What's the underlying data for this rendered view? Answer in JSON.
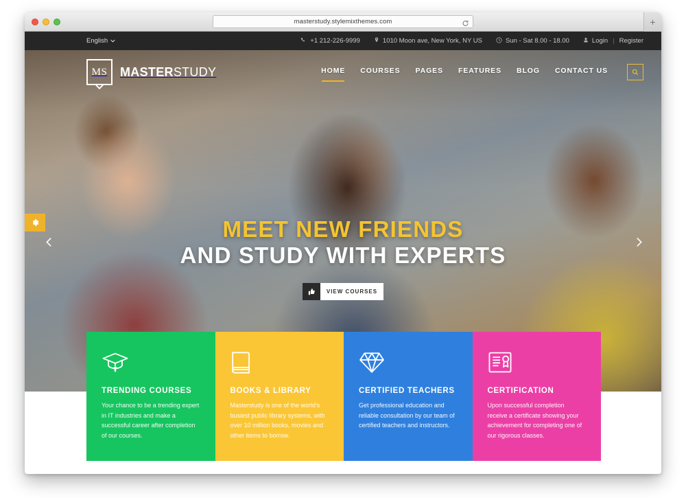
{
  "browser": {
    "url": "masterstudy.stylemixthemes.com",
    "reload_icon": "reload-icon",
    "new_tab_label": "+",
    "traffic_lights": [
      "close",
      "minimize",
      "zoom"
    ]
  },
  "topbar": {
    "language": "English",
    "language_caret": "chevron-down-icon",
    "phone": "+1 212-226-9999",
    "address": "1010 Moon ave, New York, NY US",
    "hours": "Sun - Sat 8.00 - 18.00",
    "login": "Login",
    "separator": "|",
    "register": "Register",
    "background": "#262626"
  },
  "header": {
    "logo_mark": "MS",
    "logo_bold": "MASTER",
    "logo_light": "STUDY",
    "nav": [
      {
        "label": "HOME",
        "active": true
      },
      {
        "label": "COURSES",
        "active": false
      },
      {
        "label": "PAGES",
        "active": false
      },
      {
        "label": "FEATURES",
        "active": false
      },
      {
        "label": "BLOG",
        "active": false
      },
      {
        "label": "CONTACT US",
        "active": false
      }
    ],
    "search_icon": "search-icon",
    "accent": "#f0c02f"
  },
  "hero": {
    "headline_gold": "MEET NEW FRIENDS",
    "headline_white": "AND STUDY WITH EXPERTS",
    "cta_label": "VIEW COURSES",
    "cta_icon": "thumbs-up-icon",
    "settings_icon": "gear-icon",
    "prev_icon": "chevron-left-icon",
    "next_icon": "chevron-right-icon",
    "gold": "#f4c430"
  },
  "cards": [
    {
      "icon": "graduation-cap-icon",
      "title": "TRENDING COURSES",
      "text": "Your chance to be a trending expert in IT industries and make a successful career after completion of our courses.",
      "color": "#16c55f"
    },
    {
      "icon": "book-icon",
      "title": "BOOKS & LIBRARY",
      "text": "Masterstudy is one of the world's busiest public library systems, with over 10 million books, movies and other items to borrow.",
      "color": "#fbc635"
    },
    {
      "icon": "diamond-icon",
      "title": "CERTIFIED TEACHERS",
      "text": "Get professional education and reliable consultation by our team of certified teachers and instructors.",
      "color": "#2f80de"
    },
    {
      "icon": "certificate-icon",
      "title": "CERTIFICATION",
      "text": "Upon successful completion receive a certificate showing your achievement for completing one of our rigorous classes.",
      "color": "#ec3fa6"
    }
  ]
}
